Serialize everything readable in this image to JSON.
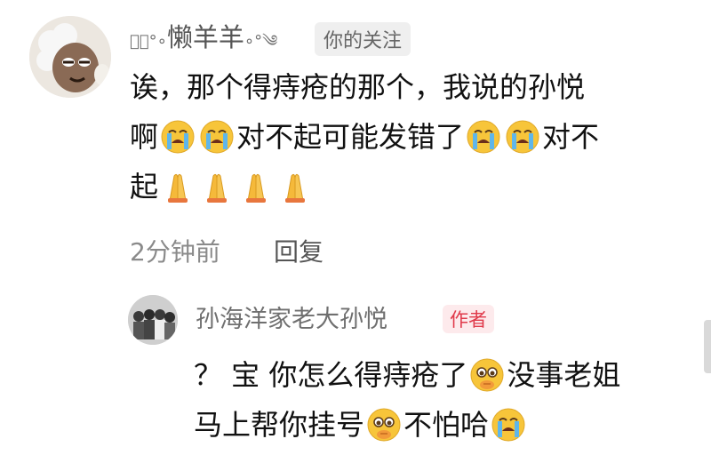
{
  "comment1": {
    "user": {
      "deco_left": "༄⃢°∘",
      "name": "懒羊羊",
      "deco_right": "∘°༄",
      "tag": "你的关注"
    },
    "line1": "诶，那个得痔疮的那个，我说的孙悦",
    "line2_a": "啊",
    "line2_b": "对不起可能发错了",
    "line2_c": "对不",
    "line3": "起",
    "time": "2分钟前",
    "reply_label": "回复"
  },
  "reply1": {
    "user": {
      "name": "孙海洋家老大孙悦",
      "tag": "作者"
    },
    "line1_a": "？ 宝 你怎么得痔疮了",
    "line1_b": "没事老姐",
    "line2_a": "马上帮你挂号",
    "line2_b": "不怕哈"
  },
  "icons": [
    "loudly-crying-emoji",
    "folded-hands-emoji",
    "pleading-face-emoji"
  ],
  "colors": {
    "name": "#6f6f6f",
    "author_tag_bg": "#fdeaec",
    "author_tag_text": "#e0394a",
    "tag_bg": "#efefef"
  }
}
